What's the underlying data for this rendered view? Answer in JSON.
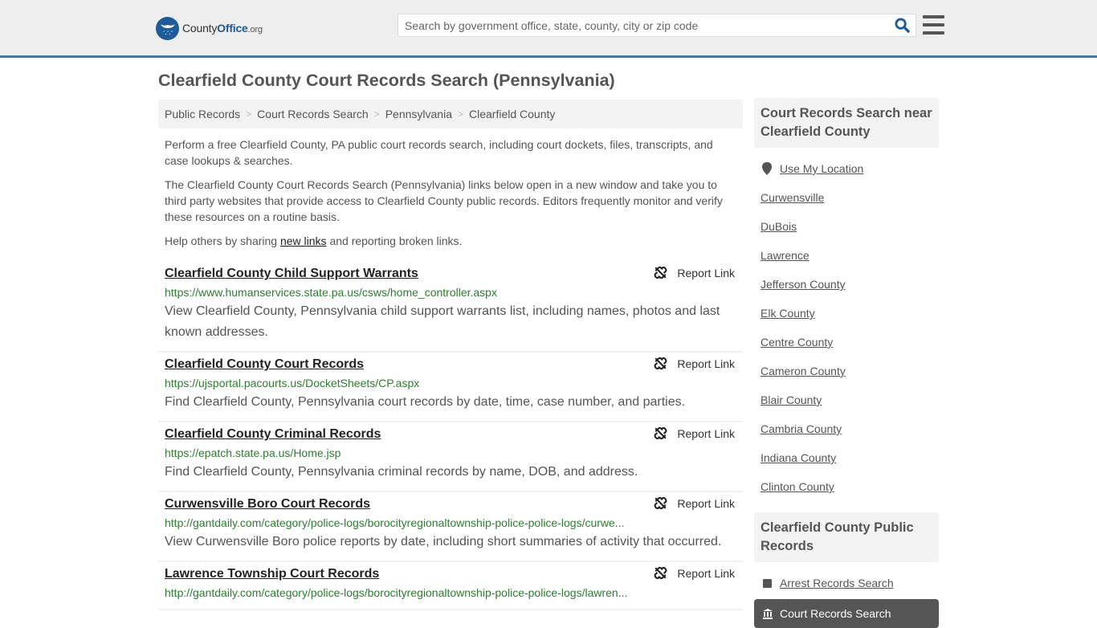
{
  "header": {
    "logo": {
      "name_part1": "County",
      "name_part2": "Office",
      "name_tld": ".org"
    },
    "search": {
      "placeholder": "Search by government office, state, county, city or zip code",
      "value": ""
    },
    "icons": {
      "search": "search-icon",
      "menu": "hamburger-menu-icon"
    },
    "colors": {
      "brand": "#1f5b99",
      "accent_border": "#3a7ead",
      "header_bg": "#eeeeee"
    }
  },
  "page": {
    "title": "Clearfield County Court Records Search (Pennsylvania)",
    "breadcrumb": [
      "Public Records",
      "Court Records Search",
      "Pennsylvania",
      "Clearfield County"
    ],
    "breadcrumb_separator": ">",
    "intro": {
      "p1": "Perform a free Clearfield County, PA public court records search, including court dockets, files, transcripts, and case lookups & searches.",
      "p2": "The Clearfield County Court Records Search (Pennsylvania) links below open in a new window and take you to third party websites that provide access to Clearfield County public records. Editors frequently monitor and verify these resources on a routine basis.",
      "p3_before": "Help others by sharing ",
      "p3_link": "new links",
      "p3_after": " and reporting broken links."
    }
  },
  "results": [
    {
      "title": "Clearfield County Child Support Warrants",
      "url": "https://www.humanservices.state.pa.us/csws/home_controller.aspx",
      "description": "View Clearfield County, Pennsylvania child support warrants list, including names, photos and last known addresses.",
      "report_label": "Report Link"
    },
    {
      "title": "Clearfield County Court Records",
      "url": "https://ujsportal.pacourts.us/DocketSheets/CP.aspx",
      "description": "Find Clearfield County, Pennsylvania court records by date, time, case number, and parties.",
      "report_label": "Report Link"
    },
    {
      "title": "Clearfield County Criminal Records",
      "url": "https://epatch.state.pa.us/Home.jsp",
      "description": "Find Clearfield County, Pennsylvania criminal records by name, DOB, and address.",
      "report_label": "Report Link"
    },
    {
      "title": "Curwensville Boro Court Records",
      "url": "http://gantdaily.com/category/police-logs/borocityregionaltownship-police-police-logs/curwe...",
      "description": "View Curwensville Boro police reports by date, including short summaries of activity that occurred.",
      "report_label": "Report Link"
    },
    {
      "title": "Lawrence Township Court Records",
      "url": "http://gantdaily.com/category/police-logs/borocityregionaltownship-police-police-logs/lawren...",
      "description": "",
      "report_label": "Report Link"
    }
  ],
  "sidebar": {
    "nearby": {
      "heading": "Court Records Search near Clearfield County",
      "use_location": "Use My Location",
      "items": [
        "Curwensville",
        "DuBois",
        "Lawrence",
        "Jefferson County",
        "Elk County",
        "Centre County",
        "Cameron County",
        "Blair County",
        "Cambria County",
        "Indiana County",
        "Clinton County"
      ]
    },
    "public_records": {
      "heading": "Clearfield County Public Records",
      "items": [
        {
          "label": "Arrest Records Search",
          "icon": "square-icon",
          "active": false
        },
        {
          "label": "Court Records Search",
          "icon": "courthouse-icon",
          "active": true
        }
      ]
    }
  }
}
